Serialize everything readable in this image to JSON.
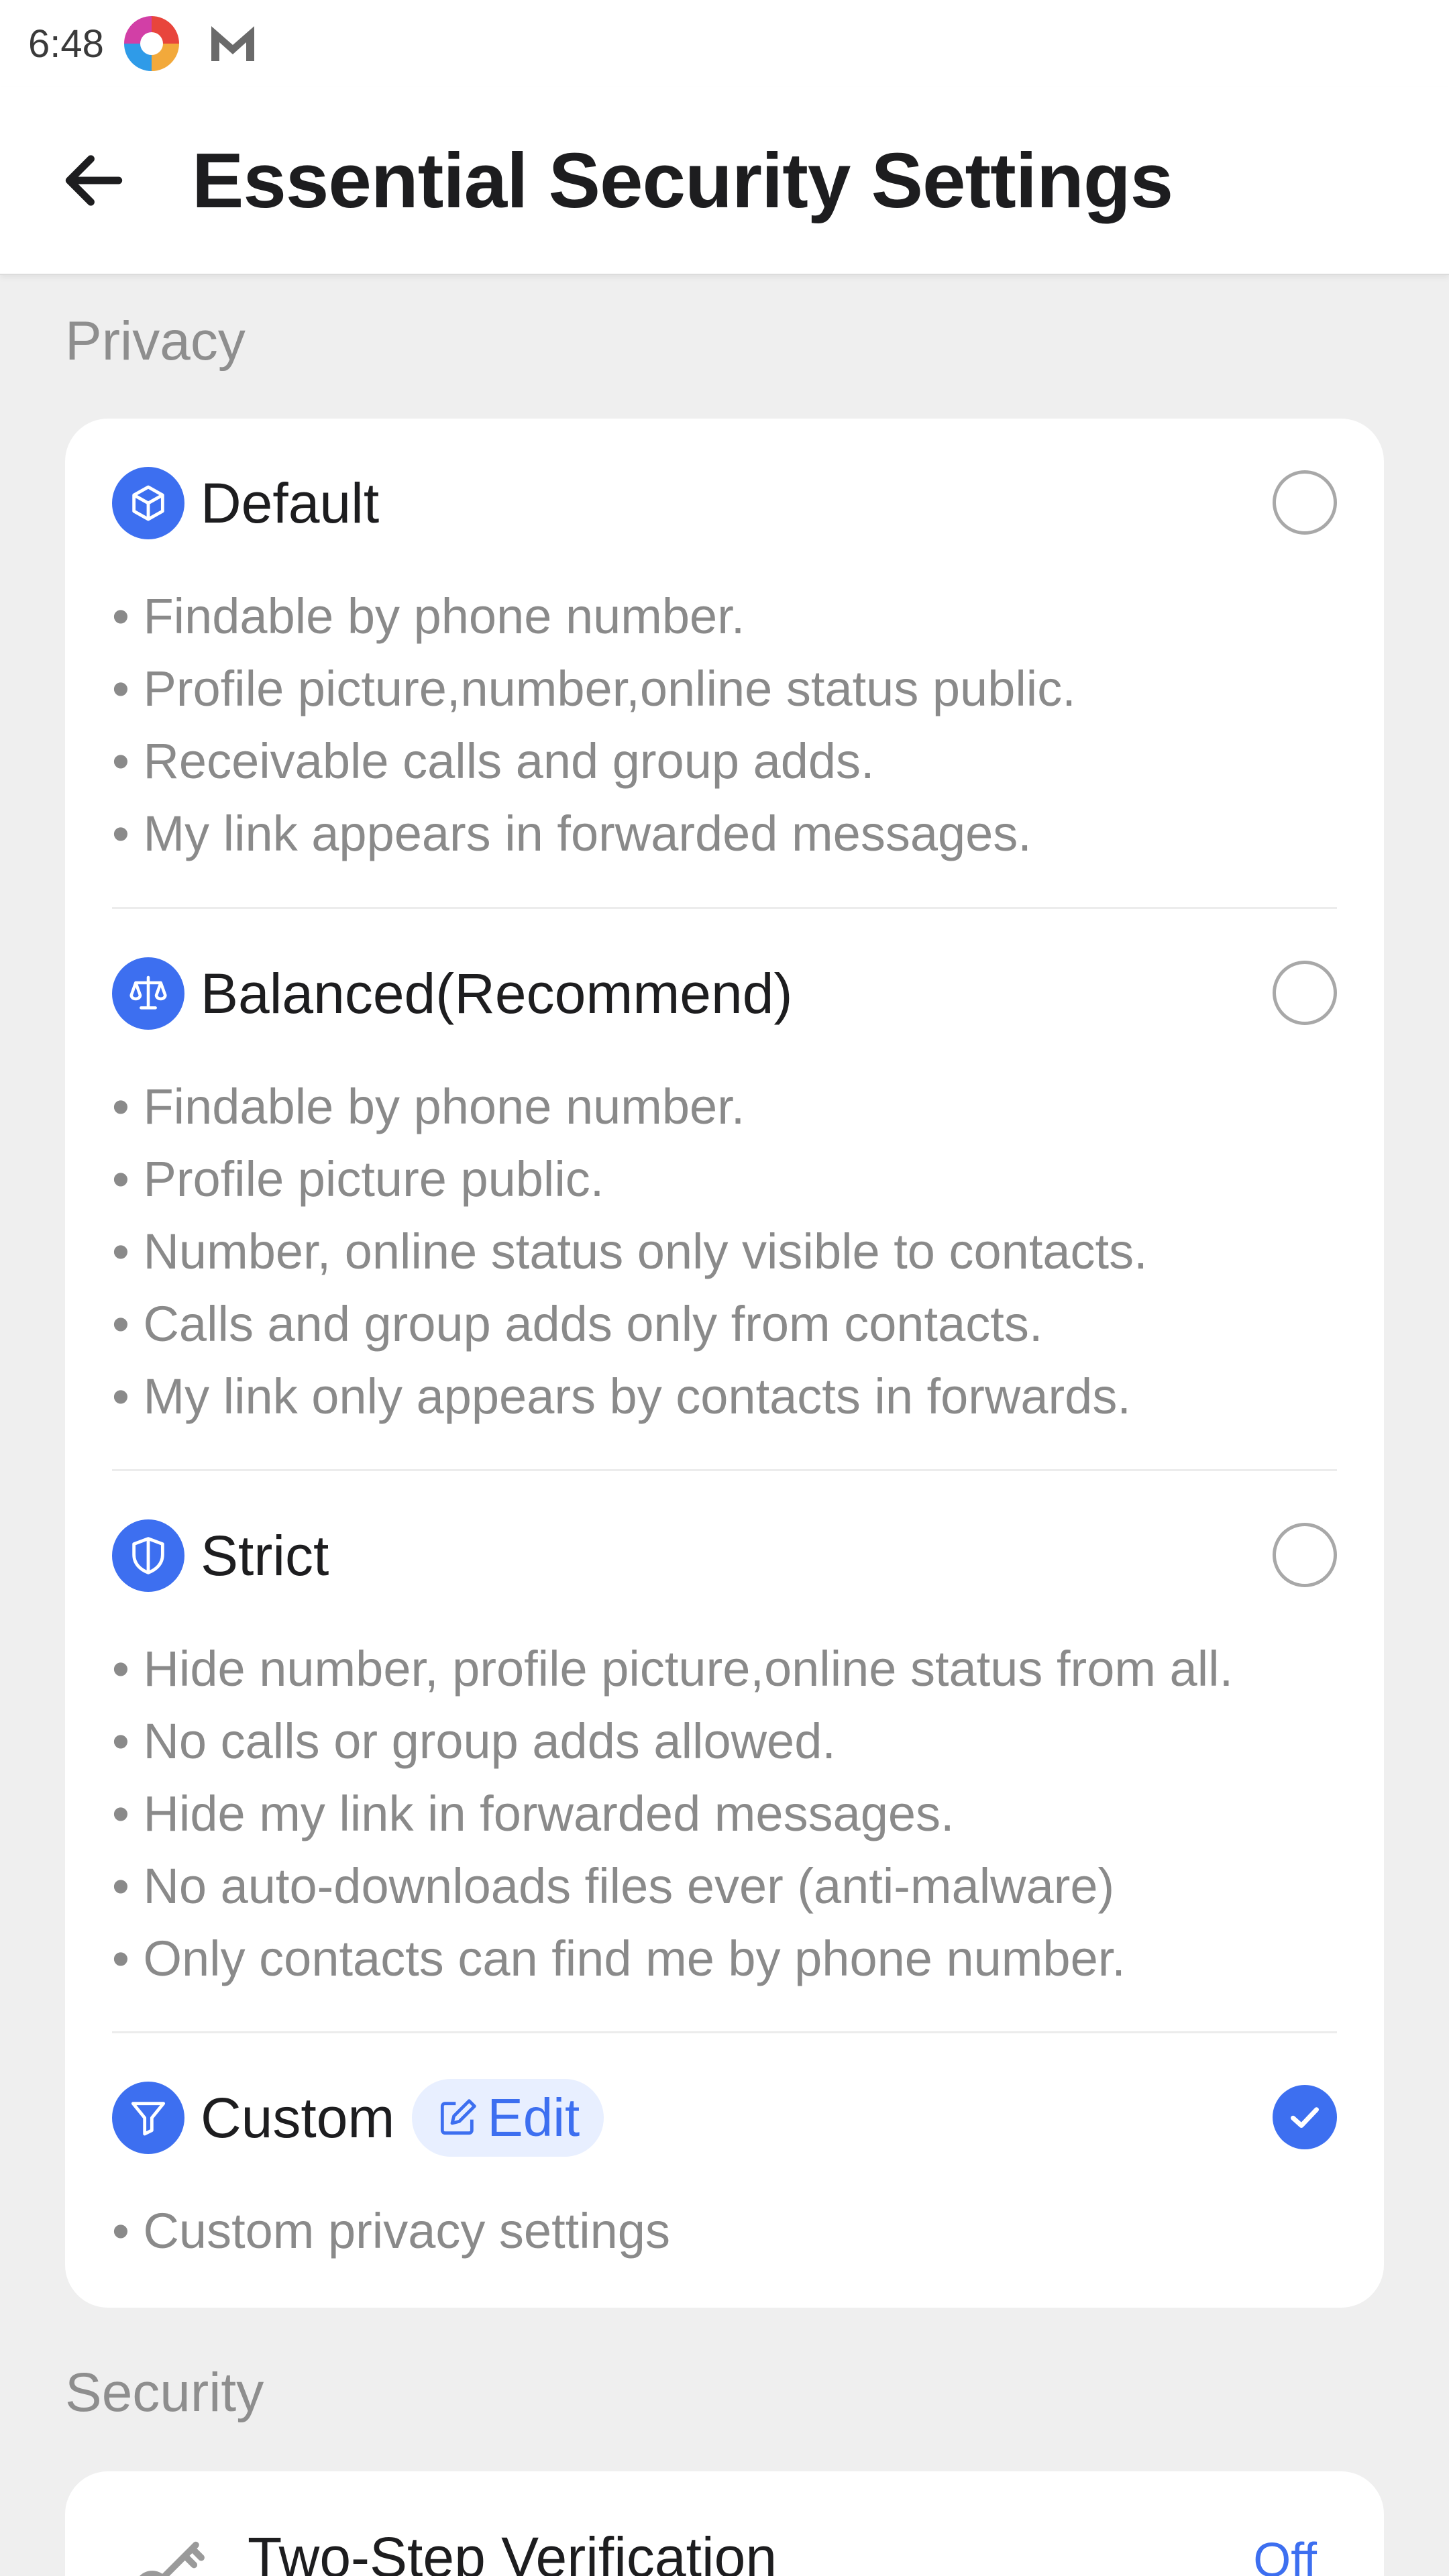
{
  "status_bar": {
    "time": "6:48"
  },
  "header": {
    "title": "Essential Security Settings"
  },
  "privacy": {
    "section_label": "Privacy",
    "options": [
      {
        "title": "Default",
        "icon": "cube-icon",
        "selected": false,
        "bullets": [
          "Findable by phone number.",
          "Profile picture,number,online status public.",
          "Receivable calls and group adds.",
          "My link appears in forwarded messages."
        ]
      },
      {
        "title": "Balanced(Recommend)",
        "icon": "scale-icon",
        "selected": false,
        "bullets": [
          "Findable by phone number.",
          "Profile picture public.",
          "Number, online status only visible to contacts.",
          "Calls and group adds only from contacts.",
          "My link only appears by contacts in forwards."
        ]
      },
      {
        "title": "Strict",
        "icon": "shield-icon",
        "selected": false,
        "bullets": [
          "Hide number, profile picture,online status from all.",
          "No calls or group adds allowed.",
          "Hide my link in forwarded messages.",
          "No auto-downloads files ever (anti-malware)",
          "Only contacts can find me by phone number."
        ]
      },
      {
        "title": "Custom",
        "icon": "filter-icon",
        "edit_label": "Edit",
        "selected": true,
        "bullets": [
          "Custom privacy settings"
        ]
      }
    ]
  },
  "security": {
    "section_label": "Security",
    "items": [
      {
        "title": "Two-Step Verification",
        "value": "Off",
        "icon": "key-icon"
      }
    ]
  },
  "colors": {
    "accent": "#3d6ff0",
    "background": "#efefef",
    "card": "#ffffff",
    "secondary_text": "#8a8a8a"
  }
}
